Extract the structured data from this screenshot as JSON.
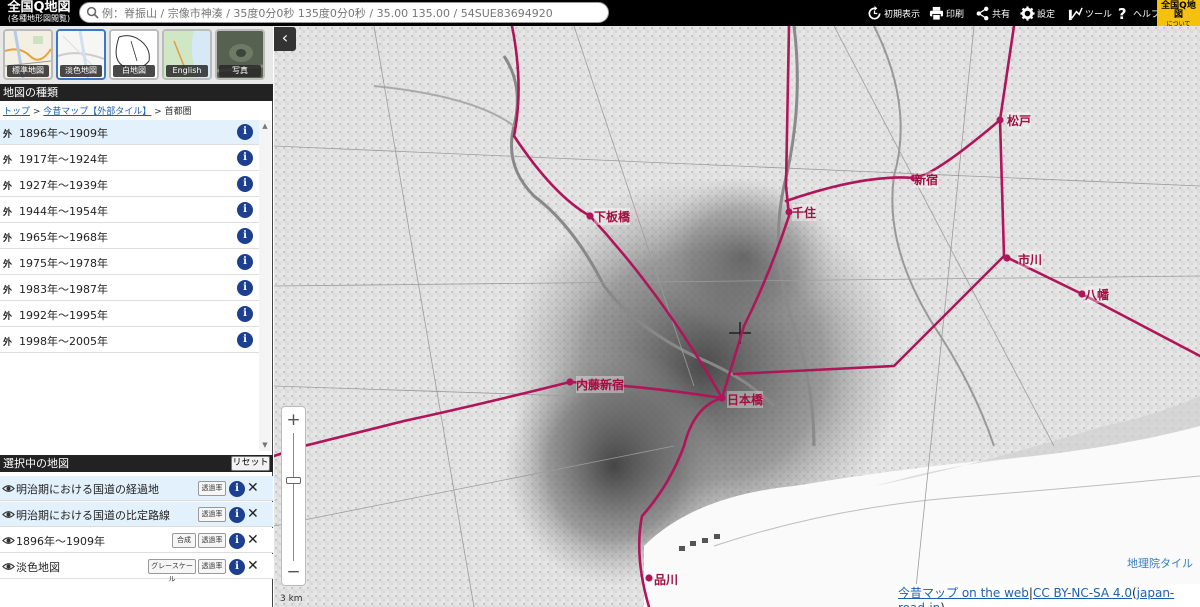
{
  "header": {
    "logo_line1": "全国Q地図",
    "logo_line2": "(各種地形図閲覧)",
    "search_placeholder": "例：脊振山 / 宗像市神湊 / 35度0分0秒 135度0分0秒 / 35.00 135.00 / 54SUE83694920",
    "buttons": [
      {
        "label": "初期表示",
        "icon": "reset-icon"
      },
      {
        "label": "印刷",
        "icon": "print-icon"
      },
      {
        "label": "共有",
        "icon": "share-icon"
      },
      {
        "label": "設定",
        "icon": "gear-icon"
      },
      {
        "label": "ツール",
        "icon": "tool-icon"
      },
      {
        "label": "ヘルプ",
        "icon": "help-icon"
      }
    ],
    "about_line1": "全国Q地図",
    "about_line2": "について"
  },
  "basemaps": [
    {
      "label": "標準地図",
      "active": false
    },
    {
      "label": "淡色地図",
      "active": true
    },
    {
      "label": "白地図",
      "active": false
    },
    {
      "label": "English",
      "active": false
    },
    {
      "label": "写真",
      "active": false
    }
  ],
  "map_types": {
    "title": "地図の種類",
    "breadcrumb": {
      "top": "トップ",
      "sep1": " > ",
      "mid": "今昔マップ【外部タイル】",
      "sep2": " > ",
      "current": "首都圏"
    },
    "items": [
      {
        "tag": "外",
        "label": "1896年～1909年",
        "selected": true
      },
      {
        "tag": "外",
        "label": "1917年～1924年",
        "selected": false
      },
      {
        "tag": "外",
        "label": "1927年～1939年",
        "selected": false
      },
      {
        "tag": "外",
        "label": "1944年～1954年",
        "selected": false
      },
      {
        "tag": "外",
        "label": "1965年～1968年",
        "selected": false
      },
      {
        "tag": "外",
        "label": "1975年～1978年",
        "selected": false
      },
      {
        "tag": "外",
        "label": "1983年～1987年",
        "selected": false
      },
      {
        "tag": "外",
        "label": "1992年～1995年",
        "selected": false
      },
      {
        "tag": "外",
        "label": "1998年～2005年",
        "selected": false
      }
    ],
    "info_label": "i"
  },
  "selected_maps": {
    "title": "選択中の地図",
    "reset_label": "リセット",
    "items": [
      {
        "label": "明治期における国道の経過地",
        "buttons": [
          "透過率"
        ]
      },
      {
        "label": "明治期における国道の比定路線",
        "buttons": [
          "透過率"
        ]
      },
      {
        "label": "1896年～1909年",
        "buttons": [
          "合成",
          "透過率"
        ]
      },
      {
        "label": "淡色地図",
        "buttons": [
          "グレースケール",
          "透過率"
        ]
      }
    ],
    "close_label": "✕"
  },
  "map": {
    "collapse_label": "‹",
    "zoom_in": "+",
    "zoom_out": "−",
    "scale_label": "3 km",
    "tile_credit": "地理院タイル",
    "attribution": {
      "link1": "今昔マップ on the web",
      "sep": "|",
      "link2": "CC BY-NC-SA 4.0",
      "paren_open": "(",
      "link3": "japan-road-jp",
      "paren_close": ")"
    },
    "stations": [
      "松戸",
      "新宿",
      "下板橋",
      "千住",
      "市川",
      "八幡",
      "内藤新宿",
      "日本橋",
      "品川"
    ],
    "route_color": "#b0155a"
  }
}
